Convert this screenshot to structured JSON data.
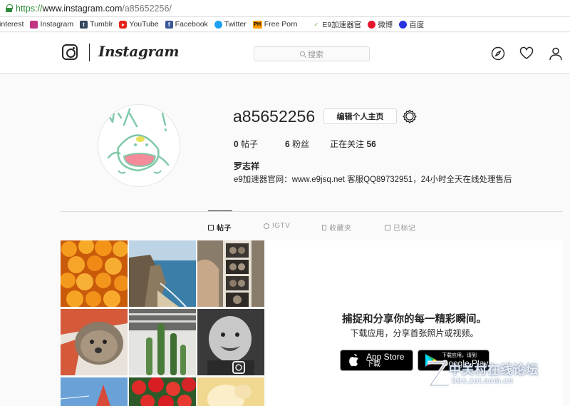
{
  "browser": {
    "url_scheme": "https://",
    "url_host": "www.instagram.com",
    "url_path": "/a85652256/",
    "bookmarks": [
      {
        "label": "interest",
        "icon": "pinterest-icon",
        "color": "#cb2027"
      },
      {
        "label": "Instagram",
        "icon": "instagram-icon",
        "color": "#c13584"
      },
      {
        "label": "Tumblr",
        "icon": "tumblr-icon",
        "color": "#35465c"
      },
      {
        "label": "YouTube",
        "icon": "youtube-icon",
        "color": "#e62117"
      },
      {
        "label": "Facebook",
        "icon": "facebook-icon",
        "color": "#3b5998"
      },
      {
        "label": "Twitter",
        "icon": "twitter-icon",
        "color": "#1da1f2"
      },
      {
        "label": "Free Porn",
        "icon": "ph-icon",
        "color": "#f90"
      },
      {
        "label": "E9加速器官",
        "icon": "e9-icon",
        "color": "#6ab04c"
      },
      {
        "label": "微博",
        "icon": "weibo-icon",
        "color": "#e6162d"
      },
      {
        "label": "百度",
        "icon": "baidu-icon",
        "color": "#2932e1"
      }
    ]
  },
  "header": {
    "wordmark": "Instagram",
    "search_placeholder": "搜索",
    "icons": [
      "compass-icon",
      "heart-icon",
      "user-icon"
    ]
  },
  "profile": {
    "username": "a85652256",
    "edit_button": "编辑个人主页",
    "stats": [
      {
        "value": "0",
        "label": "帖子"
      },
      {
        "value": "6",
        "label": "粉丝"
      },
      {
        "label": "正在关注",
        "value": "56"
      }
    ],
    "full_name": "罗志祥",
    "bio": "e9加速器官网：www.e9jsq.net 客服QQ89732951，24小时全天在线处理售后"
  },
  "tabs": [
    {
      "label": "帖子",
      "icon": "grid-icon",
      "active": true
    },
    {
      "label": "IGTV",
      "icon": "igtv-icon",
      "active": false
    },
    {
      "label": "收藏夹",
      "icon": "bookmark-icon",
      "active": false
    },
    {
      "label": "已标记",
      "icon": "tagged-icon",
      "active": false
    }
  ],
  "promo": {
    "title": "捕捉和分享你的每一精彩瞬间。",
    "subtitle": "下载应用，分享首张照片或视频。",
    "appstore_main": "App Store",
    "appstore_sub": "下载",
    "gplay_top": "下载应用，请到",
    "gplay_main": "Google Play"
  },
  "watermark": {
    "text": "中关村在线论坛",
    "url": "bbs.zol.com.cn"
  },
  "colors": {
    "accent": "#262626",
    "border": "#dbdbdb",
    "url_green": "#2e8b3a"
  }
}
